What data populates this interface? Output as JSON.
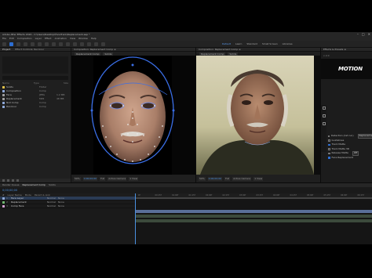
{
  "titlebar": {
    "title": "Adobe After Effects 2020 - C:\\Users\\Desktop\\FaceTrack\\Replacement.aep *"
  },
  "window_controls": {
    "minimize": "–",
    "maximize": "□",
    "close": "✕"
  },
  "menu": [
    "File",
    "Edit",
    "Composition",
    "Layer",
    "Effect",
    "Animation",
    "View",
    "Window",
    "Help"
  ],
  "workspaces": [
    "Default",
    "Learn",
    "Standard",
    "Small Screen",
    "Libraries"
  ],
  "project_panel": {
    "tabs": [
      "Project",
      "Effect Controls: Recolour"
    ],
    "columns": [
      "Name",
      "Type",
      "Size"
    ],
    "items": [
      {
        "name": "Solids",
        "type": "Folder",
        "size": "",
        "color": "#e3c34a"
      },
      {
        "name": "Composition",
        "type": "Comp",
        "size": "",
        "color": "#8fa9d9"
      },
      {
        "name": "Face",
        "type": "JPEG",
        "size": "1.2 MB",
        "color": "#9e9e9e"
      },
      {
        "name": "Replacement",
        "type": "MP4",
        "size": "48 MB",
        "color": "#9e9e9e"
      },
      {
        "name": "Null Comp",
        "type": "Comp",
        "size": "",
        "color": "#8fa9d9"
      },
      {
        "name": "Recolour",
        "type": "Comp",
        "size": "",
        "color": "#8fa9d9"
      }
    ]
  },
  "viewer_left": {
    "title": "Composition: Replacement Comp ≡",
    "subtabs": [
      "Replacement Comp",
      "Solids"
    ],
    "zoom": "50%",
    "timecode": "0;00;00;00",
    "resolution": "Full",
    "camera": "Active Camera",
    "views": "1 View"
  },
  "viewer_right": {
    "title": "Composition: Replacement Comp ≡",
    "subtabs": [
      "Replacement Comp",
      "Solids"
    ],
    "zoom": "50%",
    "timecode": "0;00;00;00",
    "resolution": "Full",
    "camera": "Active Camera",
    "views": "1 View"
  },
  "effects_panel": {
    "title": "Effects & Presets ≡",
    "version": "v 2.0",
    "logo_text": "MOTION",
    "options": [
      {
        "label": "Detection (1st run)",
        "checked": false,
        "select": "Replacement Comp"
      },
      {
        "label": "Guidelines",
        "checked": false,
        "select": ""
      },
      {
        "label": "Track Matte",
        "checked": true,
        "select": ""
      },
      {
        "label": "Track Matte 3D",
        "checked": false,
        "select": ""
      },
      {
        "label": "Release Matte",
        "checked": false,
        "select": "Off"
      },
      {
        "label": "Face Replacement",
        "checked": true,
        "select": ""
      }
    ],
    "sections": [
      "Render",
      "Adjustments",
      "Mask Feather",
      "Opacity"
    ]
  },
  "timeline": {
    "tabs": [
      "Render Queue",
      "Replacement Comp",
      "Solids"
    ],
    "timecode": "0;00;00;00",
    "columns": [
      "#",
      "Layer Name",
      "Mode",
      "Parent & Link"
    ],
    "layers": [
      {
        "num": "1",
        "name": "Face Layer",
        "mode": "Normal",
        "parent": "None",
        "color": "#8fa9d9",
        "selected": true
      },
      {
        "num": "2",
        "name": "Replacement",
        "mode": "Normal",
        "parent": "None",
        "color": "#6fb86f",
        "selected": false
      },
      {
        "num": "3",
        "name": "Comp Face",
        "mode": "Normal",
        "parent": "None",
        "color": "#d4a0d4",
        "selected": false
      }
    ],
    "ruler": [
      "0f",
      "00:15f",
      "01:00f",
      "01:15f",
      "02:00f",
      "02:15f",
      "03:00f",
      "03:15f",
      "04:00f",
      "04:15f",
      "05:00f",
      "05:15f",
      "06:00f",
      "06:15f"
    ]
  }
}
